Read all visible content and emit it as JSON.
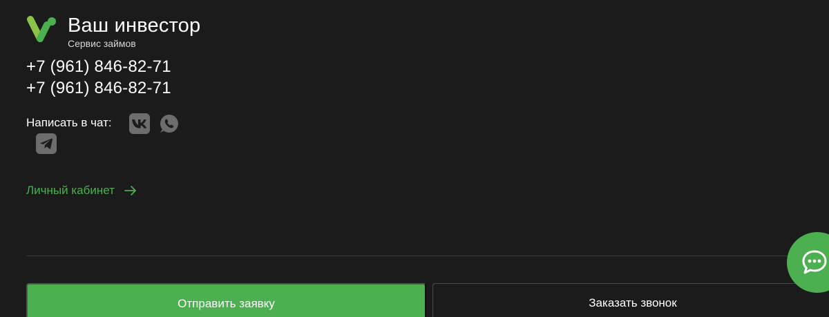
{
  "brand": {
    "title": "Ваш инвестор",
    "subtitle": "Сервис займов",
    "accent_color": "#4caf50"
  },
  "contacts": {
    "phones": [
      "+7 (961) 846-82-71",
      "+7 (961) 846-82-71"
    ],
    "chat_label": "Написать в чат:",
    "social": [
      {
        "name": "vk-icon"
      },
      {
        "name": "whatsapp-icon"
      },
      {
        "name": "telegram-icon"
      }
    ]
  },
  "account": {
    "label": "Личный кабинет",
    "icon": "arrow-right-icon"
  },
  "actions": {
    "submit_label": "Отправить заявку",
    "callback_label": "Заказать звонок"
  },
  "chat_widget": {
    "icon": "chat-bubble-icon"
  }
}
